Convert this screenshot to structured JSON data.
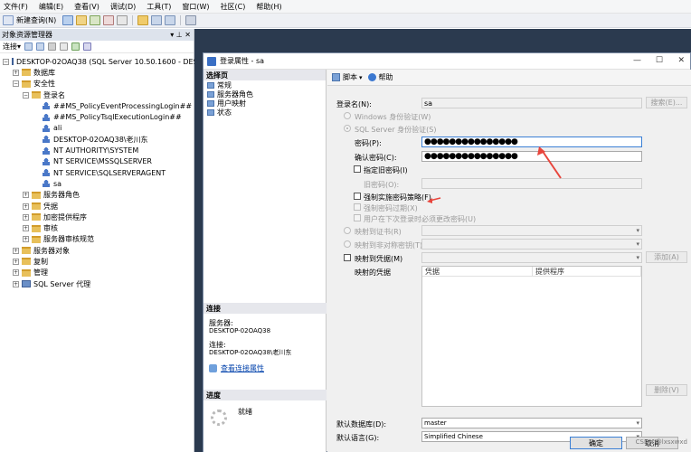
{
  "menu": [
    "文件(F)",
    "编辑(E)",
    "查看(V)",
    "调试(D)",
    "工具(T)",
    "窗口(W)",
    "社区(C)",
    "帮助(H)"
  ],
  "toolbar": {
    "new_query": "新建查询(N)"
  },
  "object_explorer": {
    "title": "对象资源管理器",
    "title_icons": "▾ ⊥ ✕",
    "connect": "连接▾",
    "nodes": [
      {
        "label": "DESKTOP-02OAQ38 (SQL Server 10.50.1600 - DESKT",
        "exp": "⊟",
        "icon": "server"
      },
      {
        "label": "数据库",
        "exp": "⊞",
        "icon": "folder"
      },
      {
        "label": "安全性",
        "exp": "⊟",
        "icon": "folder"
      },
      {
        "label": "登录名",
        "exp": "⊟",
        "icon": "folder"
      },
      {
        "label": "##MS_PolicyEventProcessingLogin##",
        "exp": "",
        "icon": "user"
      },
      {
        "label": "##MS_PolicyTsqlExecutionLogin##",
        "exp": "",
        "icon": "user"
      },
      {
        "label": "ali",
        "exp": "",
        "icon": "user"
      },
      {
        "label": "DESKTOP-02OAQ38\\老川东",
        "exp": "",
        "icon": "user"
      },
      {
        "label": "NT AUTHORITY\\SYSTEM",
        "exp": "",
        "icon": "user"
      },
      {
        "label": "NT SERVICE\\MSSQLSERVER",
        "exp": "",
        "icon": "user"
      },
      {
        "label": "NT SERVICE\\SQLSERVERAGENT",
        "exp": "",
        "icon": "user"
      },
      {
        "label": "sa",
        "exp": "",
        "icon": "user"
      },
      {
        "label": "服务器角色",
        "exp": "⊞",
        "icon": "folder"
      },
      {
        "label": "凭据",
        "exp": "⊞",
        "icon": "folder"
      },
      {
        "label": "加密提供程序",
        "exp": "⊞",
        "icon": "folder"
      },
      {
        "label": "审核",
        "exp": "⊞",
        "icon": "folder"
      },
      {
        "label": "服务器审核规范",
        "exp": "⊞",
        "icon": "folder"
      },
      {
        "label": "服务器对象",
        "exp": "⊞",
        "icon": "folder"
      },
      {
        "label": "复制",
        "exp": "⊞",
        "icon": "folder"
      },
      {
        "label": "管理",
        "exp": "⊞",
        "icon": "folder"
      },
      {
        "label": "SQL Server 代理",
        "exp": "⊞",
        "icon": "server"
      }
    ]
  },
  "dialog": {
    "title": "登录属性 - sa",
    "win_min": "—",
    "win_max": "☐",
    "win_close": "✕",
    "select_page": "选择页",
    "pages": [
      "常规",
      "服务器角色",
      "用户映射",
      "状态"
    ],
    "connection_header": "连接",
    "server_label": "服务器:",
    "server_value": "DESKTOP-02OAQ38",
    "conn_label": "连接:",
    "conn_value": "DESKTOP-02OAQ38\\老川东",
    "view_conn": "查看连接属性",
    "progress_header": "进度",
    "progress_status": "就绪",
    "script": "脚本",
    "help": "帮助",
    "login_name_label": "登录名(N):",
    "login_name_value": "sa",
    "search_btn": "搜索(E)...",
    "win_auth": "Windows 身份验证(W)",
    "sql_auth": "SQL Server 身份验证(S)",
    "password_label": "密码(P):",
    "password_value": "●●●●●●●●●●●●●●●",
    "confirm_label": "确认密码(C):",
    "confirm_value": "●●●●●●●●●●●●●●●",
    "specify_old": "指定旧密码(I)",
    "old_pwd": "旧密码(O):",
    "enforce_policy": "强制实施密码策略(F)",
    "enforce_expiration": "强制密码过期(X)",
    "must_change": "用户在下次登录时必须更改密码(U)",
    "map_cert": "映射到证书(R)",
    "map_asym": "映射到非对称密钥(T)",
    "map_cred": "映射到凭据(M)",
    "add_btn": "添加(A)",
    "mapped_creds": "映射的凭据",
    "col_cred": "凭据",
    "col_provider": "提供程序",
    "remove_btn": "删除(V)",
    "default_db_label": "默认数据库(D):",
    "default_db_value": "master",
    "default_lang_label": "默认语言(G):",
    "default_lang_value": "Simplified Chinese",
    "ok": "确定",
    "cancel": "取消"
  },
  "watermark": "CSDN @lxsxwxd",
  "colors": {
    "arrow": "#e8453c",
    "focus": "#3a7fd5",
    "workspace": "#2b3a4f"
  }
}
